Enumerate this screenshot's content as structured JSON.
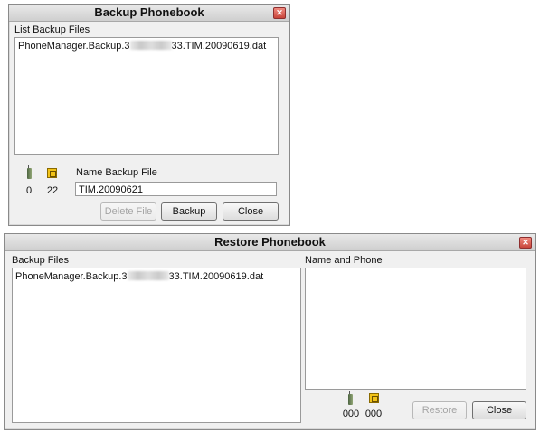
{
  "backup": {
    "title": "Backup Phonebook",
    "list_label": "List Backup Files",
    "files": [
      {
        "prefix": "PhoneManager.Backup.3",
        "suffix": "33.TIM.20090619.dat"
      }
    ],
    "phone_count": "0",
    "sim_count": "22",
    "name_label": "Name Backup File",
    "name_value": "TIM.20090621",
    "delete_label": "Delete File",
    "backup_label": "Backup",
    "close_label": "Close"
  },
  "restore": {
    "title": "Restore Phonebook",
    "files_label": "Backup Files",
    "files": [
      {
        "prefix": "PhoneManager.Backup.3",
        "suffix": "33.TIM.20090619.dat"
      }
    ],
    "contacts_label": "Name and Phone",
    "phone_count": "000",
    "sim_count": "000",
    "restore_label": "Restore",
    "close_label": "Close"
  },
  "icons": {
    "close": "close-icon",
    "phone": "phone-memory-icon",
    "sim": "sim-card-icon"
  },
  "colors": {
    "titlebar": "#d6d6d6",
    "window_bg": "#f0f0f0",
    "close_button": "#d24b3f"
  }
}
